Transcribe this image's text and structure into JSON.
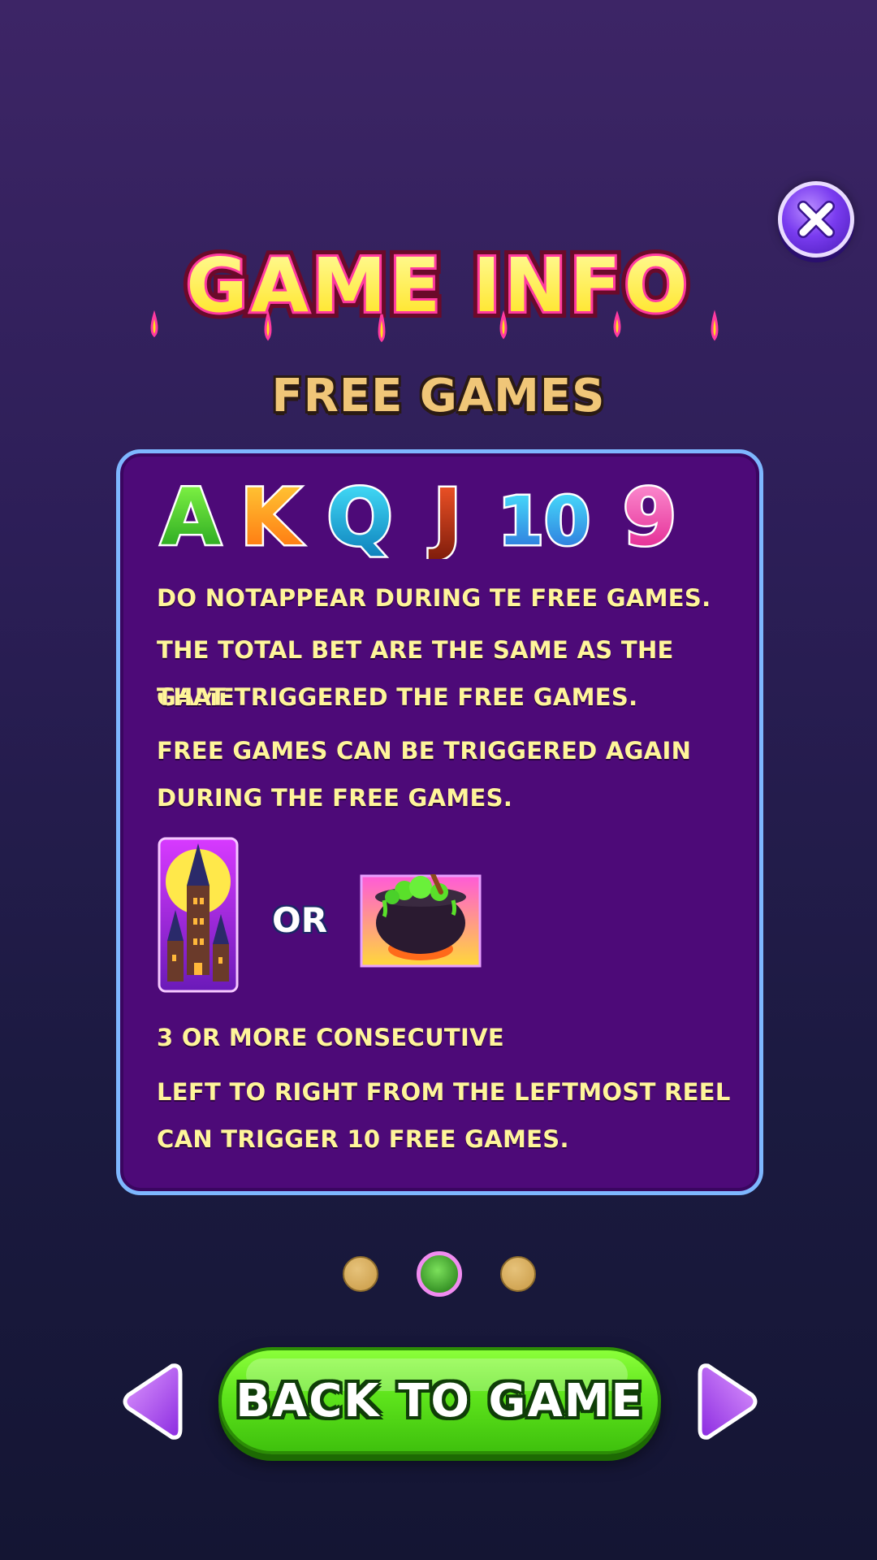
{
  "header": {
    "title": "GAME INFO",
    "subtitle": "FREE GAMES",
    "close_icon": "close-icon"
  },
  "panel": {
    "symbol_letters": [
      "A",
      "K",
      "Q",
      "J",
      "10",
      "9"
    ],
    "line1": "DO NOTAPPEAR DURING TE FREE GAMES.",
    "para2": [
      "THE TOTAL BET ARE THE SAME AS THE GAME",
      "THAT TRIGGERED THE FREE GAMES."
    ],
    "para3": [
      "FREE GAMES CAN BE TRIGGERED AGAIN",
      "DURING THE FREE GAMES."
    ],
    "or_label": "OR",
    "scatter_icons": [
      "castle-icon",
      "cauldron-icon"
    ],
    "line4": "3 OR MORE CONSECUTIVE",
    "para5": [
      "LEFT TO RIGHT FROM THE LEFTMOST REEL",
      "CAN TRIGGER 10 FREE GAMES."
    ]
  },
  "pager": {
    "pages": 3,
    "current": 2
  },
  "footer": {
    "back_label": "BACK TO GAME"
  },
  "colors": {
    "background_top": "#3d2566",
    "panel_fill": "#4d0a78",
    "panel_border": "#7eb7ff",
    "text_yellow": "#fff59a",
    "subtitle_gold": "#f0c678",
    "button_green": "#5ee41c",
    "close_purple": "#7a3cf0"
  }
}
